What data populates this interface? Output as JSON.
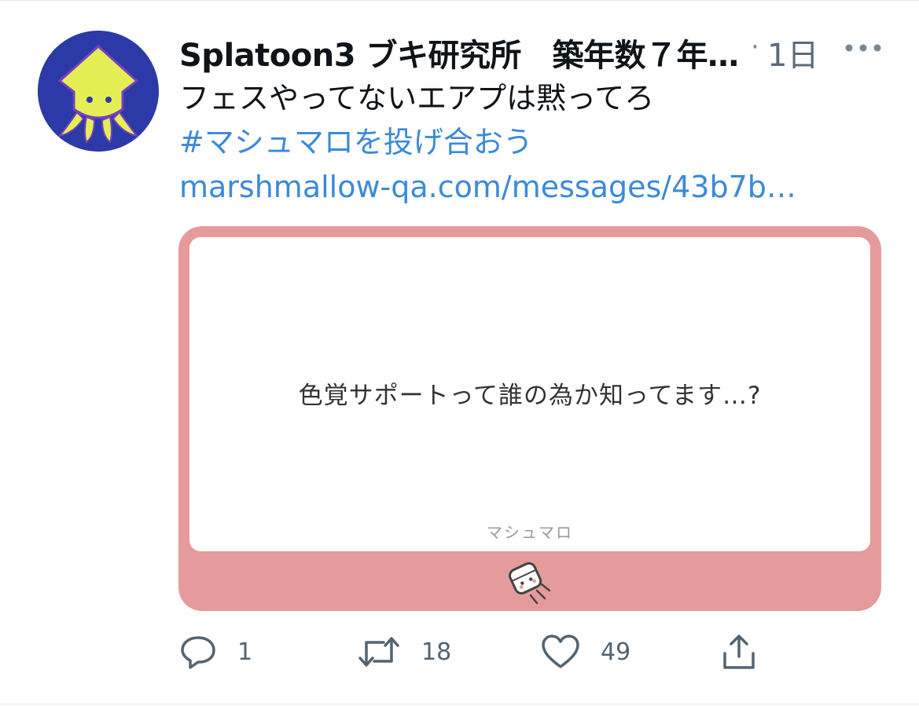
{
  "tweet": {
    "display_name": "Splatoon3 ブキ研究所　築年数７年…",
    "separator": "·",
    "time": "1日",
    "text": "フェスやってないエアプは黙ってろ",
    "hashtag": "#マシュマロを投げ合おう",
    "link": "marshmallow-qa.com/messages/43b7b…"
  },
  "card": {
    "question": "色覚サポートって誰の為か知ってます…?",
    "brand": "マシュマロ",
    "background_color": "#e59b9b"
  },
  "actions": {
    "reply_count": "1",
    "retweet_count": "18",
    "like_count": "49"
  },
  "icons": {
    "avatar": "squid-avatar-icon",
    "more": "more-dots-icon",
    "reply": "reply-bubble-icon",
    "retweet": "retweet-arrows-icon",
    "like": "heart-icon",
    "share": "share-upload-icon",
    "card_logo": "marshmallow-logo-icon"
  },
  "colors": {
    "link": "#3b8ad9",
    "text": "#0f1419",
    "muted": "#536471"
  }
}
